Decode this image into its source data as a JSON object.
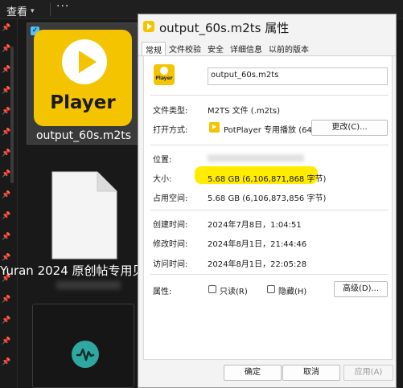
{
  "explorer": {
    "toolbar": {
      "view_label": "查看",
      "more_label": "···"
    },
    "selected_file_name": "output_60s.m2ts",
    "selected_file_icon_text": "Player",
    "doc_caption": "Yuran 2024 原创帖专用贝",
    "icons": {
      "audio_file": "waveform-icon",
      "doc_file": "document-icon"
    }
  },
  "dialog": {
    "title": "output_60s.m2ts 属性",
    "tabs": [
      "常规",
      "文件校验",
      "安全",
      "详细信息",
      "以前的版本"
    ],
    "active_tab": "常规",
    "icon_text": "Player",
    "file_name": "output_60s.m2ts",
    "file_type": {
      "label": "文件类型:",
      "value": "M2TS 文件 (.m2ts)"
    },
    "opens_with": {
      "label": "打开方式:",
      "value": "PotPlayer 专用播放 (64",
      "change_button": "更改(C)..."
    },
    "location": {
      "label": "位置:"
    },
    "size": {
      "label": "大小:",
      "value": "5.68 GB (6,106,871,868 字节)"
    },
    "size_on_disk": {
      "label": "占用空间:",
      "value": "5.68 GB (6,106,873,856 字节)"
    },
    "created": {
      "label": "创建时间:",
      "value": "2024年7月8日，1:04:51"
    },
    "modified": {
      "label": "修改时间:",
      "value": "2024年8月1日，21:44:46"
    },
    "accessed": {
      "label": "访问时间:",
      "value": "2024年8月1日，22:05:28"
    },
    "attributes": {
      "label": "属性:",
      "readonly": "只读(R)",
      "hidden": "隐藏(H)",
      "advanced_button": "高级(D)..."
    },
    "buttons": {
      "ok": "确定",
      "cancel": "取消",
      "apply": "应用(A)"
    },
    "colors": {
      "highlight": "#ffec00",
      "brand": "#f5c400"
    }
  }
}
